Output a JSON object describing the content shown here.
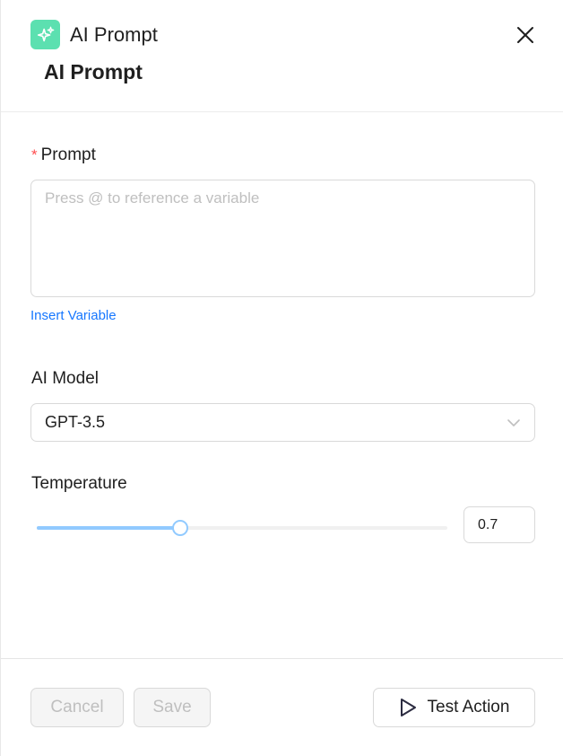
{
  "header": {
    "app_title": "AI Prompt",
    "sub_title": "AI Prompt",
    "icon": "sparkles-icon",
    "icon_color": "#5ce0b0",
    "close_icon": "close-icon"
  },
  "prompt": {
    "required_mark": "*",
    "label": "Prompt",
    "value": "",
    "placeholder": "Press @ to reference a variable",
    "insert_variable_label": "Insert Variable"
  },
  "model": {
    "label": "AI Model",
    "selected": "GPT-3.5"
  },
  "temperature": {
    "label": "Temperature",
    "value": "0.7",
    "slider_fraction": 0.35
  },
  "footer": {
    "cancel_label": "Cancel",
    "save_label": "Save",
    "test_label": "Test Action",
    "test_icon": "play-icon"
  },
  "colors": {
    "accent": "#1677ff",
    "slider": "#91caff",
    "required": "#ff4d4f"
  }
}
